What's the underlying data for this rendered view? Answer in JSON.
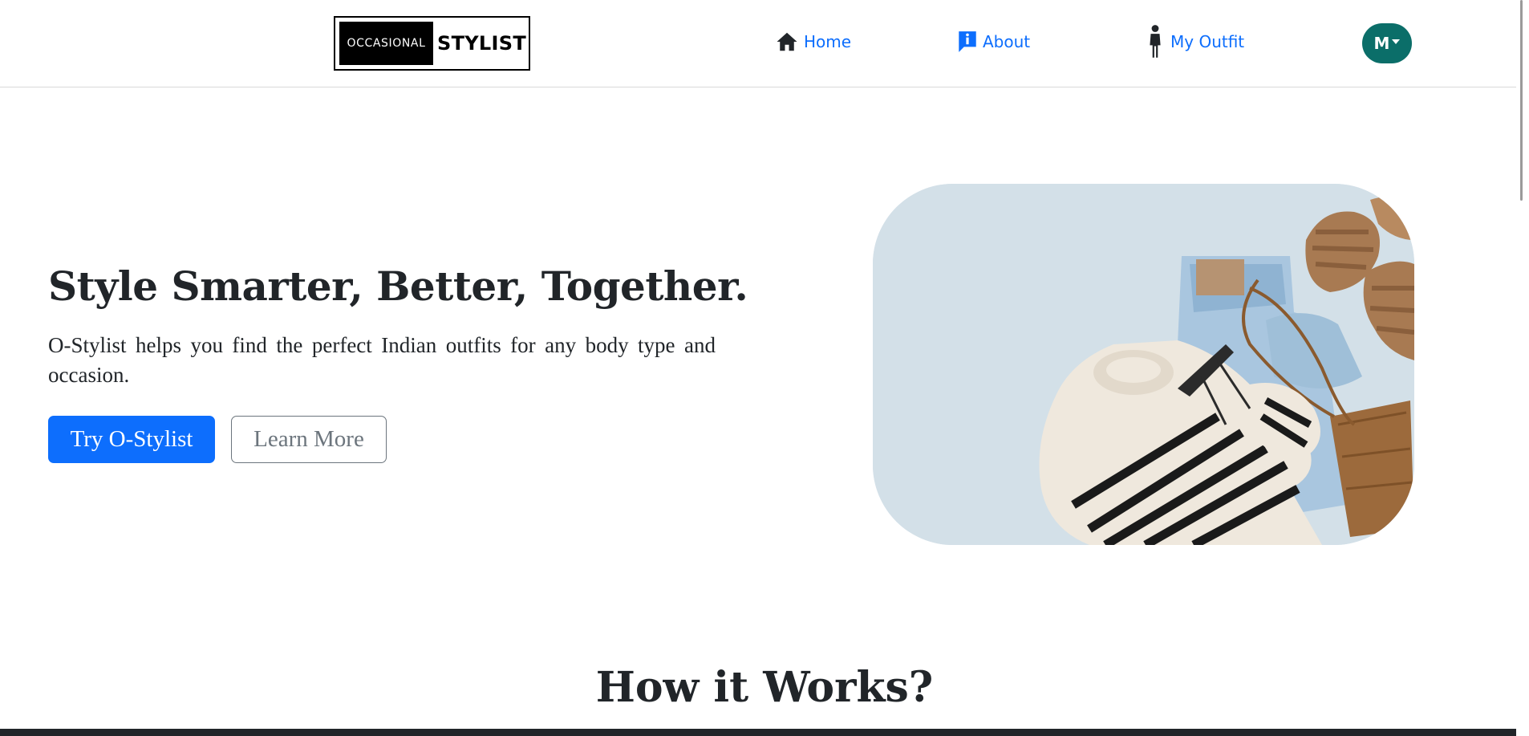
{
  "navbar": {
    "logo": {
      "left_text": "OCCASIONAL",
      "right_text": "STYLIST"
    },
    "links": [
      {
        "label": "Home",
        "icon": "home-icon"
      },
      {
        "label": "About",
        "icon": "info-icon"
      },
      {
        "label": "My Outfit",
        "icon": "person-icon"
      }
    ],
    "user_avatar": {
      "initial": "M",
      "color": "#0b6e69"
    }
  },
  "hero": {
    "title": "Style Smarter, Better, Together.",
    "subtitle": "O-Stylist helps you find the perfect Indian outfits for any body type and occasion.",
    "primary_button": "Try O-Stylist",
    "secondary_button": "Learn More",
    "image_alt": "Flat lay of striped sweater, jeans, sandals, sunglasses and bag"
  },
  "how_it_works": {
    "title": "How it Works?"
  },
  "colors": {
    "primary": "#0d6efd",
    "avatar": "#0b6e69",
    "text": "#212529",
    "muted": "#6c757d"
  }
}
